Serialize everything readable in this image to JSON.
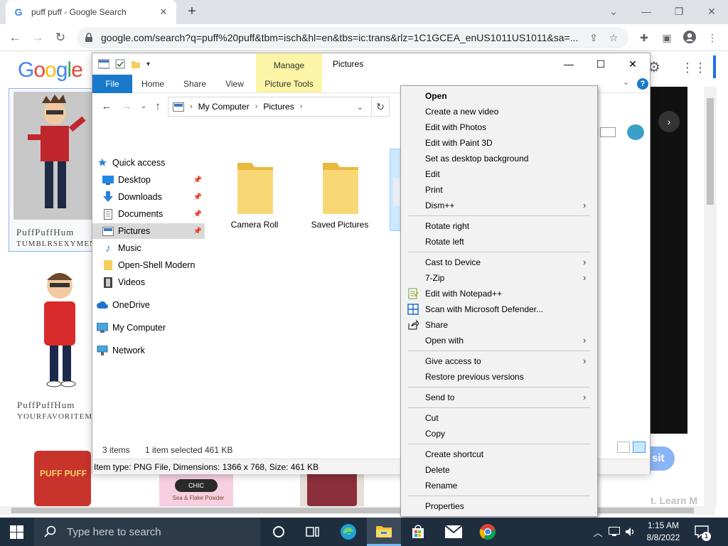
{
  "browser": {
    "tab_title": "puff puff - Google Search",
    "url": "google.com/search?q=puff%20puff&tbm=isch&hl=en&tbs=ic:trans&rlz=1C1GCEA_enUS1011US1011&sa=...",
    "new_tab_label": "+"
  },
  "google": {
    "logo_letters": [
      "G",
      "o",
      "o",
      "g",
      "l",
      "e"
    ],
    "logo_colors": [
      "#4285f4",
      "#ea4335",
      "#fbbc05",
      "#4285f4",
      "#34a853",
      "#ea4335"
    ],
    "thumb_captions": [
      {
        "title": "PuffPuffHum",
        "source": "TUMBLRSEXYMEN"
      },
      {
        "title": "PuffPuffHum",
        "source": "YOURFAVORITEM"
      }
    ],
    "product_labels": [
      "PUFF PUFF",
      "CHIC",
      "Sea & Flake Powder"
    ],
    "visit_btn": "sit",
    "learn_more": "t. Learn More"
  },
  "explorer": {
    "title": "Pictures",
    "manage_tab": "Manage",
    "picture_tools_tab": "Picture Tools",
    "tabs": [
      "File",
      "Home",
      "Share",
      "View"
    ],
    "help": "?",
    "breadcrumbs": [
      "My Computer",
      "Pictures"
    ],
    "nav": {
      "quick_access": "Quick access",
      "items": [
        {
          "label": "Desktop",
          "pinned": true
        },
        {
          "label": "Downloads",
          "pinned": true
        },
        {
          "label": "Documents",
          "pinned": true
        },
        {
          "label": "Pictures",
          "pinned": true
        },
        {
          "label": "Music",
          "pinned": false
        },
        {
          "label": "Open-Shell Modern",
          "pinned": false
        },
        {
          "label": "Videos",
          "pinned": false
        }
      ],
      "onedrive": "OneDrive",
      "my_computer": "My Computer",
      "network": "Network"
    },
    "folders": [
      "Camera Roll",
      "Saved Pictures"
    ],
    "status": {
      "items": "3 items",
      "selected": "1 item selected",
      "size": "461 KB"
    },
    "details": "Item type: PNG File, Dimensions: 1366 x 768, Size: 461 KB"
  },
  "context_menu": {
    "groups": [
      [
        {
          "label": "Open",
          "bold": true
        },
        {
          "label": "Create a new video"
        },
        {
          "label": "Edit with Photos"
        },
        {
          "label": "Edit with Paint 3D"
        },
        {
          "label": "Set as desktop background"
        },
        {
          "label": "Edit"
        },
        {
          "label": "Print"
        },
        {
          "label": "Dism++",
          "submenu": true
        }
      ],
      [
        {
          "label": "Rotate right"
        },
        {
          "label": "Rotate left"
        }
      ],
      [
        {
          "label": "Cast to Device",
          "submenu": true
        },
        {
          "label": "7-Zip",
          "submenu": true
        },
        {
          "label": "Edit with Notepad++",
          "icon": "notepad-plus-icon"
        },
        {
          "label": "Scan with Microsoft Defender...",
          "icon": "defender-shield-icon"
        },
        {
          "label": "Share",
          "icon": "share-icon"
        },
        {
          "label": "Open with",
          "submenu": true
        }
      ],
      [
        {
          "label": "Give access to",
          "submenu": true
        },
        {
          "label": "Restore previous versions"
        }
      ],
      [
        {
          "label": "Send to",
          "submenu": true
        }
      ],
      [
        {
          "label": "Cut"
        },
        {
          "label": "Copy"
        }
      ],
      [
        {
          "label": "Create shortcut"
        },
        {
          "label": "Delete"
        },
        {
          "label": "Rename"
        }
      ],
      [
        {
          "label": "Properties"
        }
      ]
    ]
  },
  "taskbar": {
    "search_placeholder": "Type here to search",
    "time": "1:15 AM",
    "date": "8/8/2022",
    "notification_count": "1"
  }
}
